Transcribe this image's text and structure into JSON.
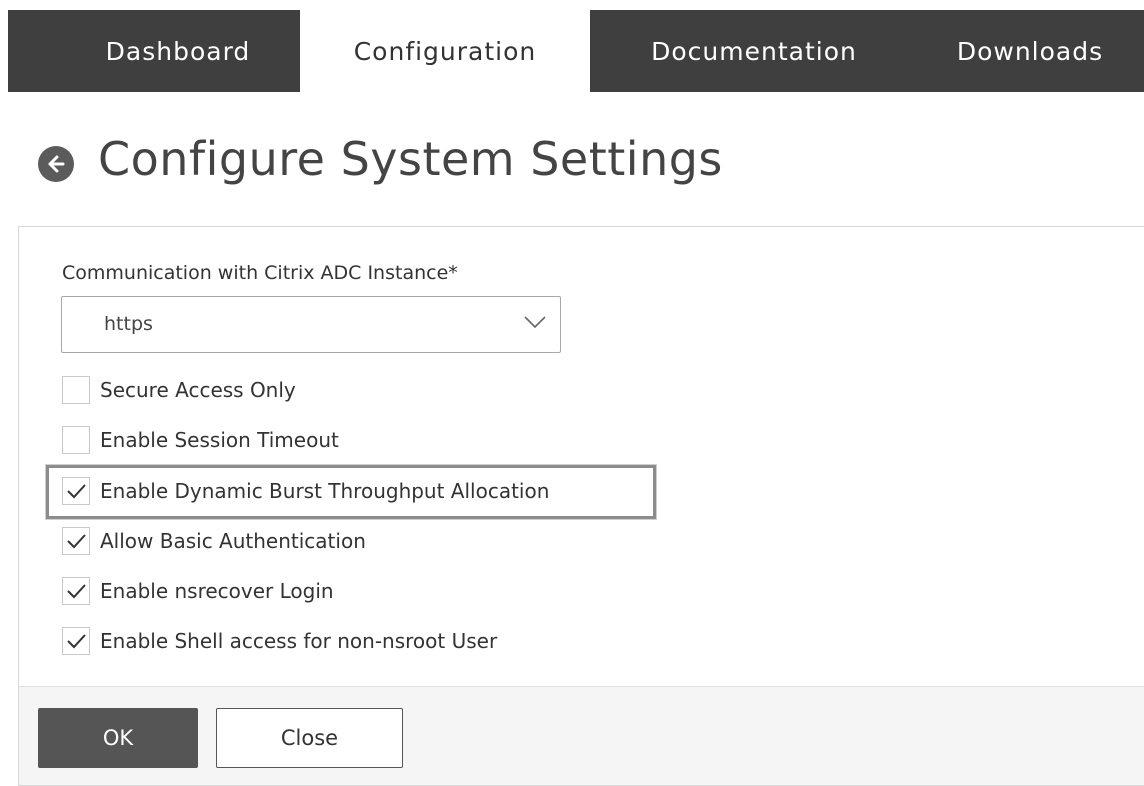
{
  "nav": {
    "tabs": [
      {
        "label": "Dashboard",
        "active": false
      },
      {
        "label": "Configuration",
        "active": true
      },
      {
        "label": "Documentation",
        "active": false
      },
      {
        "label": "Downloads",
        "active": false
      }
    ]
  },
  "page": {
    "title": "Configure System Settings",
    "back_icon": "back-arrow-circle-icon"
  },
  "form": {
    "communication_label": "Communication with Citrix ADC Instance*",
    "communication_value": "https",
    "checkboxes": [
      {
        "label": "Secure Access Only",
        "checked": false
      },
      {
        "label": "Enable Session Timeout",
        "checked": false
      },
      {
        "label": "Enable Dynamic Burst Throughput Allocation",
        "checked": true,
        "highlighted": true
      },
      {
        "label": "Allow Basic Authentication",
        "checked": true
      },
      {
        "label": "Enable nsrecover Login",
        "checked": true
      },
      {
        "label": "Enable Shell access for non-nsroot User",
        "checked": true
      }
    ]
  },
  "footer": {
    "ok_label": "OK",
    "close_label": "Close"
  },
  "colors": {
    "nav_background": "#3f3f3f",
    "primary_button": "#555555",
    "footer_background": "#f5f5f5"
  }
}
